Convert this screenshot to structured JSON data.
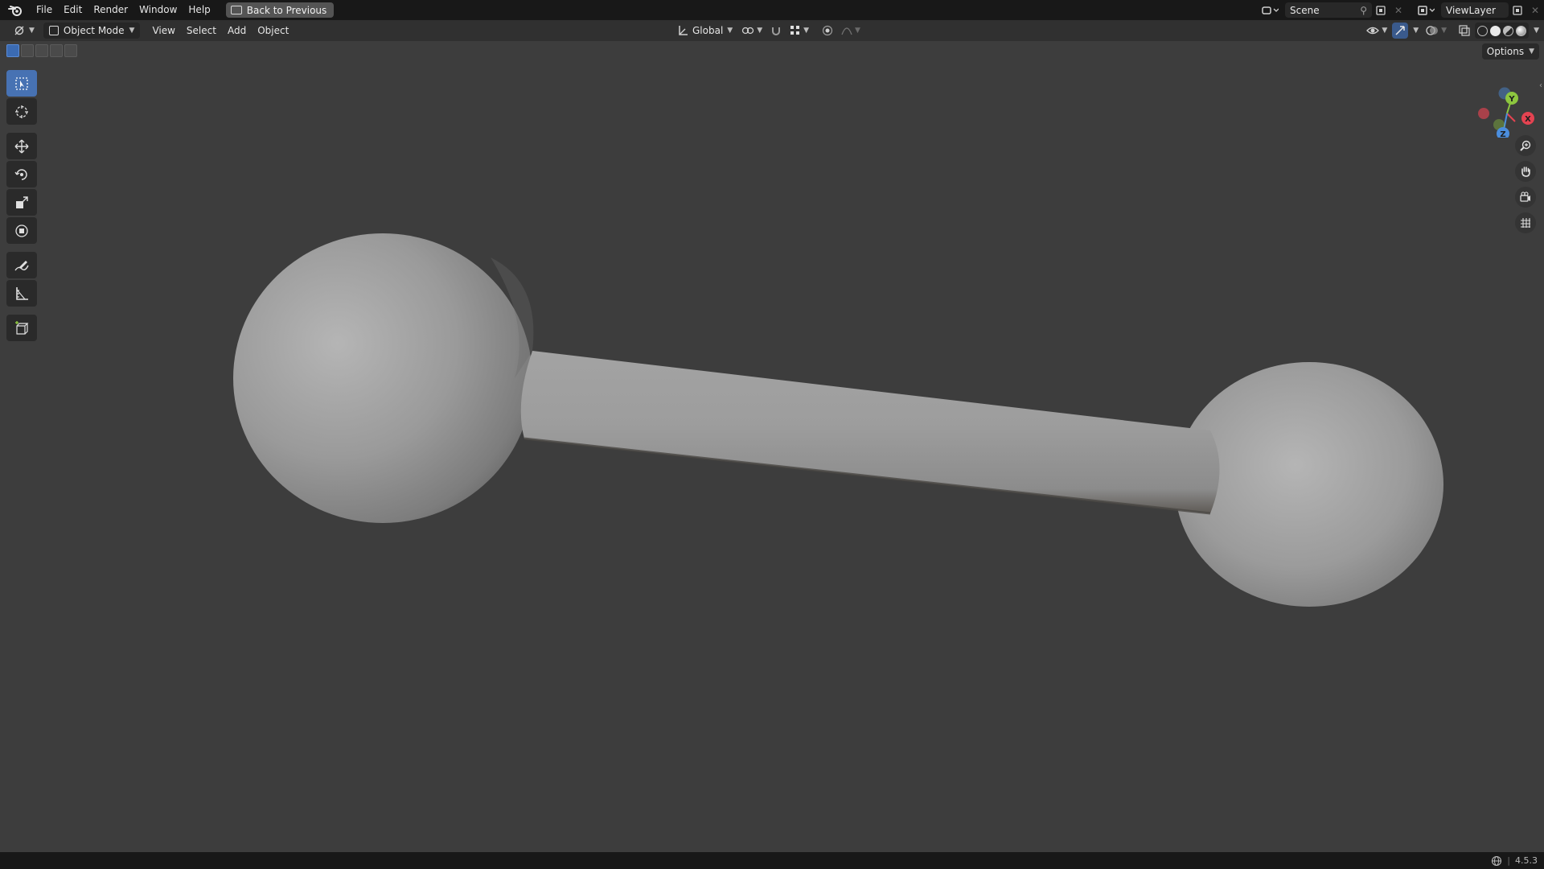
{
  "menubar": {
    "items": [
      "File",
      "Edit",
      "Render",
      "Window",
      "Help"
    ],
    "back_button": "Back to Previous",
    "scene": "Scene",
    "view_layer": "ViewLayer"
  },
  "header": {
    "mode": "Object Mode",
    "menus": [
      "View",
      "Select",
      "Add",
      "Object"
    ],
    "orientation": "Global",
    "options": "Options"
  },
  "toolbar": {
    "tools": [
      "select-box",
      "cursor",
      "move",
      "rotate",
      "scale",
      "transform",
      "annotate",
      "measure",
      "add-cube"
    ],
    "active": "select-box"
  },
  "gizmo": {
    "axes": [
      "Y",
      "X",
      "Z"
    ],
    "colors": {
      "x": "#e44351",
      "y": "#8dc63f",
      "z": "#4b8ede"
    }
  },
  "scene_objects": {
    "description_color": "#9c9c9c"
  },
  "statusbar": {
    "version": "4.5.3"
  },
  "colors": {
    "accent": "#4772b3",
    "viewport_bg": "#3d3d3d",
    "topbar_bg": "#181818",
    "header_bg": "#303030"
  }
}
